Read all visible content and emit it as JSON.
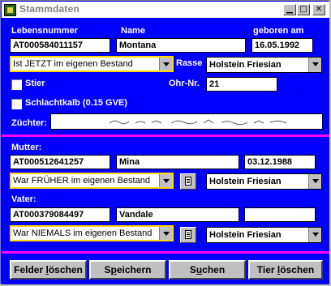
{
  "window": {
    "title": "Stammdaten"
  },
  "animal": {
    "labels": {
      "lebensnummer": "Lebensnummer",
      "name": "Name",
      "geboren": "geboren am",
      "rasse": "Rasse",
      "ohr_nr": "Ohr-Nr.",
      "zuechter": "Züchter:"
    },
    "lebensnummer": "AT000584011157",
    "name": "Montana",
    "geboren": "16.05.1992",
    "bestand": "Ist JETZT im eigenen Bestand",
    "rasse": "Holstein Friesian",
    "ohr_nr": "21",
    "stier_label": "Stier",
    "schlachtkalb_label": "Schlachtkalb (0.15 GVE)"
  },
  "mutter": {
    "label": "Mutter:",
    "lebensnummer": "AT000512641257",
    "name": "Mina",
    "geboren": "03.12.1988",
    "bestand": "War FRÜHER im eigenen Bestand",
    "rasse": "Holstein Friesian"
  },
  "vater": {
    "label": "Vater:",
    "lebensnummer": "AT000379084497",
    "name": "Vandale",
    "geboren": "",
    "bestand": "War NIEMALS im eigenen Bestand",
    "rasse": "Holstein Friesian"
  },
  "buttons": {
    "felder_pre": "Felder ",
    "felder_ul": "l",
    "felder_post": "öschen",
    "speichern_pre": "S",
    "speichern_ul": "p",
    "speichern_post": "eichern",
    "suchen_pre": "S",
    "suchen_ul": "u",
    "suchen_post": "chen",
    "tier_pre": "Tier ",
    "tier_ul": "l",
    "tier_post": "öschen"
  },
  "colors": {
    "background": "#0000ff",
    "separator": "#ff00ff",
    "highlight": "#ffd800"
  },
  "icons": [
    "app-icon",
    "minimize-icon",
    "maximize-icon",
    "close-icon",
    "document-icon",
    "dropdown-arrow-icon"
  ]
}
